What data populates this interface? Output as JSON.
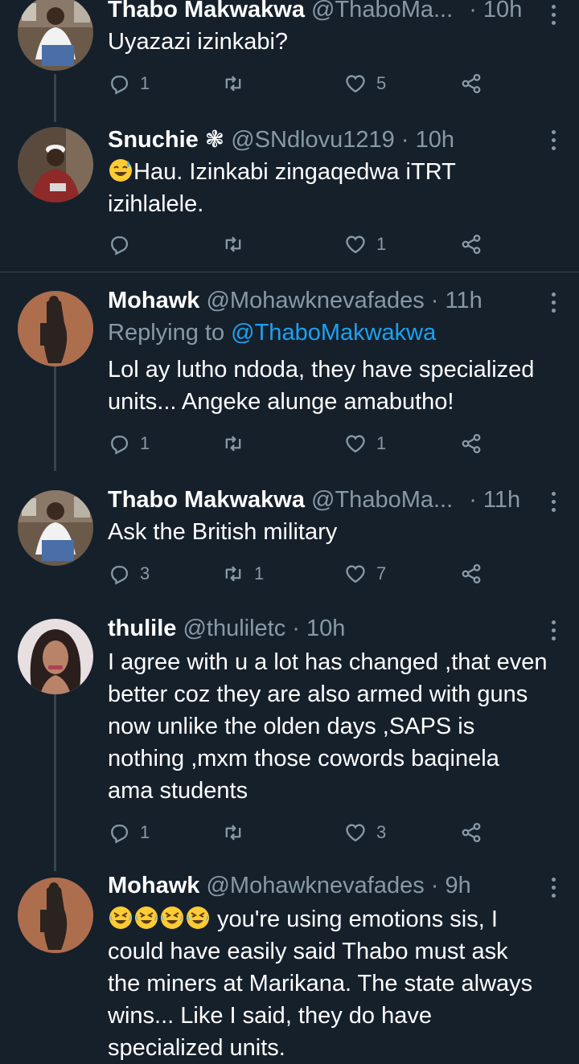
{
  "tweets": [
    {
      "name": "Thabo Makwakwa",
      "handle": "@ThaboMa...",
      "time": "· 10h",
      "text": "Uyazazi izinkabi?",
      "replies": "1",
      "retweets": "",
      "likes": "5",
      "avatar": "man-white-shirt-avatar"
    },
    {
      "name": "Snuchie ❃",
      "handle": "@SNdlovu1219",
      "time": "· 10h",
      "text_line1": "Hau. Izinkabi zingaqedwa iTRT",
      "text_line2": "izihlalele.",
      "replies": "",
      "retweets": "",
      "likes": "1",
      "avatar": "man-white-cap-avatar"
    },
    {
      "name": "Mohawk",
      "handle": "@Mohawknevafades",
      "time": "· 11h",
      "reply_prefix": "Replying to",
      "reply_to": "@ThaboMakwakwa",
      "text_line1": "Lol ay lutho ndoda, they have specialized",
      "text_line2": "units... Angeke alunge amabutho!",
      "replies": "1",
      "retweets": "",
      "likes": "1",
      "avatar": "statue-avatar"
    },
    {
      "name": "Thabo Makwakwa",
      "handle": "@ThaboMa...",
      "time": "· 11h",
      "text": "Ask the British military",
      "replies": "3",
      "retweets": "1",
      "likes": "7",
      "avatar": "man-white-shirt-avatar"
    },
    {
      "name": "thulile",
      "handle": "@thuliletc",
      "time": "· 10h",
      "text_lines": [
        "I agree with u a lot has changed ,that even",
        "better coz they are also armed with guns",
        "now unlike the olden days ,SAPS is",
        "nothing ,mxm those cowords baqinela",
        "ama students"
      ],
      "replies": "1",
      "retweets": "",
      "likes": "3",
      "avatar": "woman-avatar"
    },
    {
      "name": "Mohawk",
      "handle": "@Mohawknevafades",
      "time": "· 9h",
      "text_line1": " you're using emotions sis, I",
      "text_lines": [
        "could have easily said Thabo must ask",
        "the miners at Marikana. The state always",
        "wins... Like I said, they do have",
        "specialized units."
      ],
      "avatar": "statue-avatar"
    }
  ],
  "colors": {
    "background": "#15202b",
    "muted": "#8899a6",
    "link": "#1da1f2",
    "divider": "#38444d"
  },
  "icons": [
    "reply-icon",
    "retweet-icon",
    "like-icon",
    "share-icon",
    "more-icon",
    "grinning-sweat-emoji",
    "rofl-emoji"
  ]
}
